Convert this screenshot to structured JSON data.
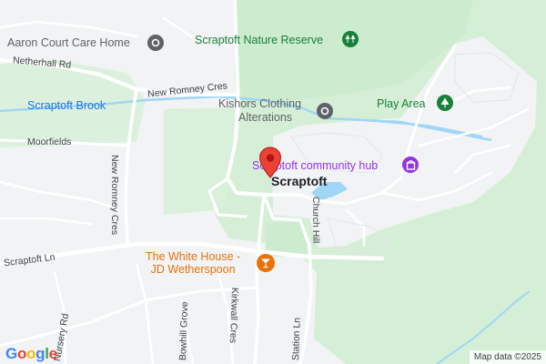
{
  "map": {
    "places": {
      "center": "Scraptoft"
    },
    "poi": {
      "care_home": "Aaron Court Care Home",
      "nature_reserve": "Scraptoft Nature Reserve",
      "clothing_line1": "Kishors Clothing",
      "clothing_line2": "Alterations",
      "play_area": "Play Area",
      "community_hub": "Scraptoft community hub",
      "white_house_line1": "The White House -",
      "white_house_line2": "JD Wetherspoon"
    },
    "water": {
      "brook": "Scraptoft Brook"
    },
    "roads": {
      "netherhall": "Netherhall Rd",
      "new_romney_cres_top": "New Romney Cres",
      "new_romney_cres_side": "New Romney Cres",
      "moorfields": "Moorfields",
      "scraptoft_ln": "Scraptoft Ln",
      "church_hill": "Church Hill",
      "station_ln": "Station Ln",
      "bowhill_grove": "Bowhill Grove",
      "kirkwall_cres": "Kirkwall Cres",
      "nursery_rd": "Nursery Rd"
    },
    "attribution": "Map data ©2025",
    "logo": [
      "G",
      "o",
      "o",
      "g",
      "l",
      "e"
    ],
    "colors": {
      "background": "#f1f3f4",
      "park": "#cdeccf",
      "park_light": "#e1f3e2",
      "water": "#9fd6f5",
      "road": "#ffffff",
      "pin": "#ea4335",
      "poi_gray": "#5f6368",
      "poi_green": "#188038",
      "poi_purple": "#9334e6",
      "poi_orange": "#e8710a"
    },
    "icons": {
      "care_home": "gray-dot-icon",
      "nature_reserve": "trees-icon",
      "clothing": "gray-dot-icon",
      "play_area": "tree-icon",
      "community_hub": "community-icon",
      "white_house": "cocktail-icon",
      "pin": "map-pin-icon"
    }
  }
}
